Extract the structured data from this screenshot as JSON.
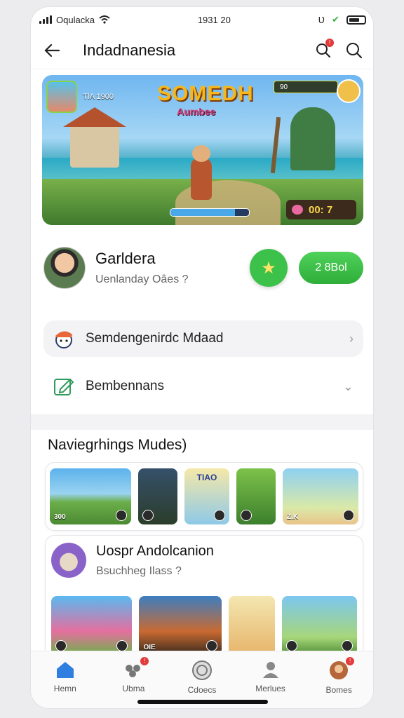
{
  "status_bar": {
    "carrier": "Oqulacka",
    "time": "1931 20"
  },
  "header": {
    "title": "Indadnanesia",
    "search_badge": "!"
  },
  "banner": {
    "logo": "SOMEDH",
    "logo_sub": "Aumbee",
    "top_left_label": "TIA 1900",
    "hud_label": "90",
    "timer": "00: 7",
    "progress": 0.82
  },
  "profile": {
    "name": "Garldera",
    "subtitle": "Uenlanday Oâes ?",
    "action_button": "2 8Bol"
  },
  "menu": [
    {
      "label": "Semdengenirdc Mdaad",
      "icon": "mascot-icon",
      "chevron": "›"
    },
    {
      "label": "Bembennans",
      "icon": "edit-icon",
      "chevron": "⌄"
    }
  ],
  "section_title": "Naviegrhings Mudes)",
  "games": [
    {
      "tag": "300",
      "top": ""
    },
    {
      "tag": "",
      "top": ""
    },
    {
      "tag": "",
      "top": "TIAO"
    },
    {
      "tag": "",
      "top": ""
    },
    {
      "tag": "Z.K",
      "top": ""
    }
  ],
  "recommend": {
    "name": "Uospr Andolcanion",
    "subtitle": "Bsuchheg Ilass ?",
    "thumbs": [
      {
        "tag": "",
        "top": ""
      },
      {
        "tag": "OIE",
        "top": ""
      },
      {
        "tag": "",
        "top": ""
      },
      {
        "tag": "",
        "top": ""
      }
    ]
  },
  "tabs": [
    {
      "label": "Hemn",
      "icon": "home-icon",
      "badge": ""
    },
    {
      "label": "Ubma",
      "icon": "friends-icon",
      "badge": "!"
    },
    {
      "label": "Cdoecs",
      "icon": "games-icon",
      "badge": ""
    },
    {
      "label": "Merlues",
      "icon": "profile-icon",
      "badge": ""
    },
    {
      "label": "Bomes",
      "icon": "avatar-icon",
      "badge": "!"
    }
  ],
  "colors": {
    "accent_green": "#3cc24a",
    "tab_active": "#2f7fe0",
    "badge_red": "#e23b3b"
  }
}
